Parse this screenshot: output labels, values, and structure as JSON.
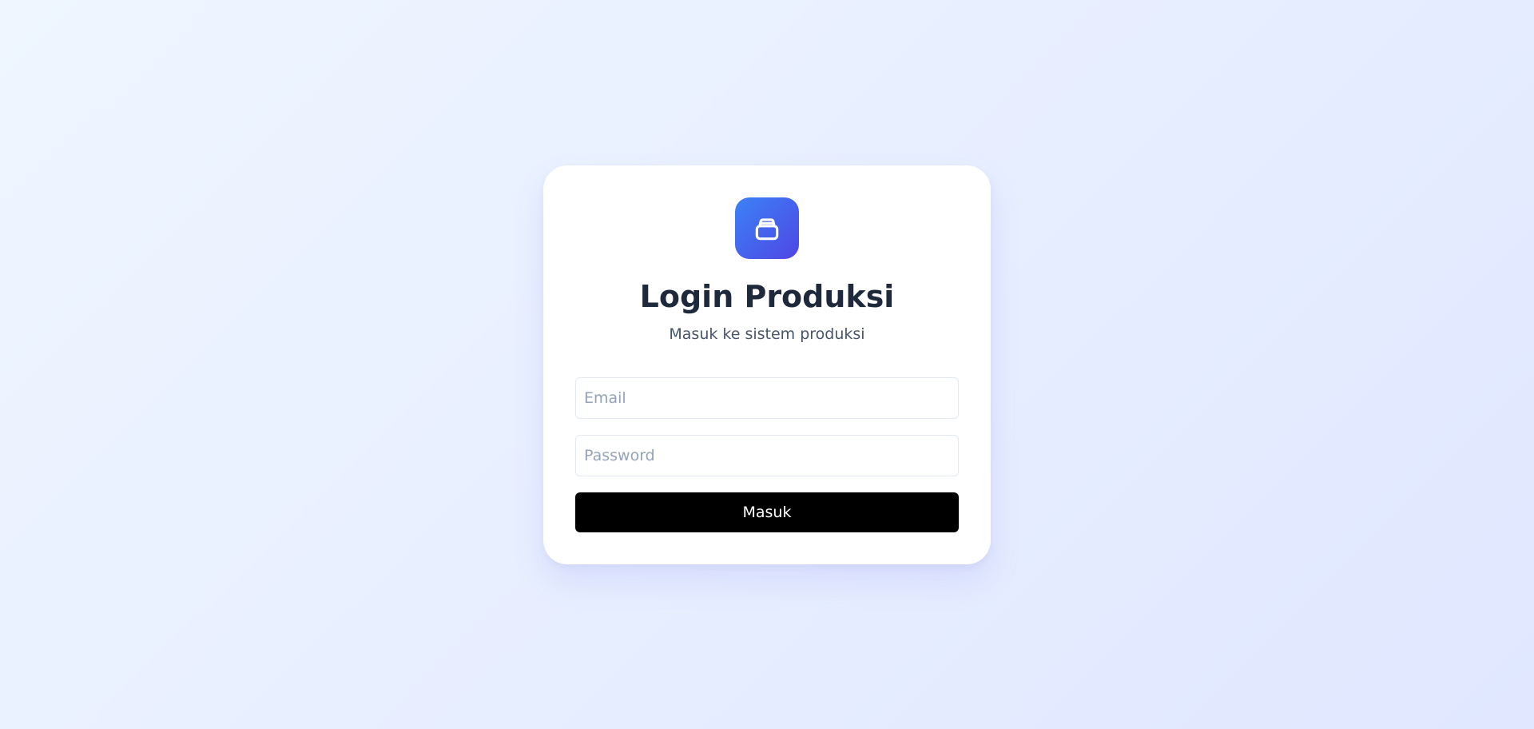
{
  "login": {
    "logo_icon": "package-icon",
    "title": "Login Produksi",
    "subtitle": "Masuk ke sistem produksi",
    "email": {
      "value": "",
      "placeholder": "Email"
    },
    "password": {
      "value": "",
      "placeholder": "Password"
    },
    "submit_label": "Masuk"
  },
  "colors": {
    "background_start": "#eff6ff",
    "background_end": "#e0e7ff",
    "logo_gradient_start": "#3b82f6",
    "logo_gradient_end": "#4f46e5",
    "title": "#1e293b",
    "subtitle": "#475569",
    "button": "#000000",
    "button_text": "#ffffff"
  }
}
